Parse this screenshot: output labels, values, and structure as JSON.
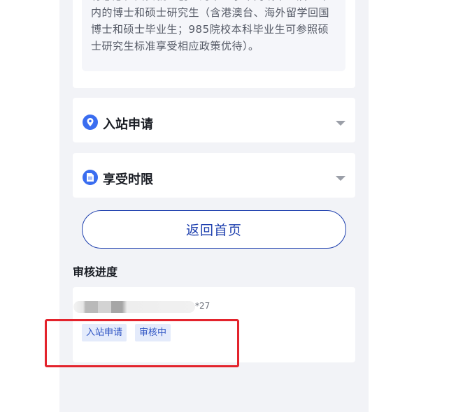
{
  "info": {
    "text": "有意愿在西安就业创业的毕业学年内或毕业后一年内的博士和硕士研究生（含港澳台、海外留学回国博士和硕士毕业生；985院校本科毕业生可参照硕士研究生标准享受相应政策优待）。"
  },
  "accordions": [
    {
      "title": "入站申请",
      "icon": "location-pin-icon"
    },
    {
      "title": "享受时限",
      "icon": "document-icon"
    }
  ],
  "home_button": {
    "label": "返回首页"
  },
  "progress": {
    "section_title": "审核进度",
    "applicant_suffix": "*27",
    "tags": [
      "入站申请",
      "审核中"
    ]
  },
  "colors": {
    "primary": "#1d3fae",
    "tag_bg": "#e4ebfb",
    "highlight": "#e3232c",
    "page_bg": "#f2f3f7"
  }
}
